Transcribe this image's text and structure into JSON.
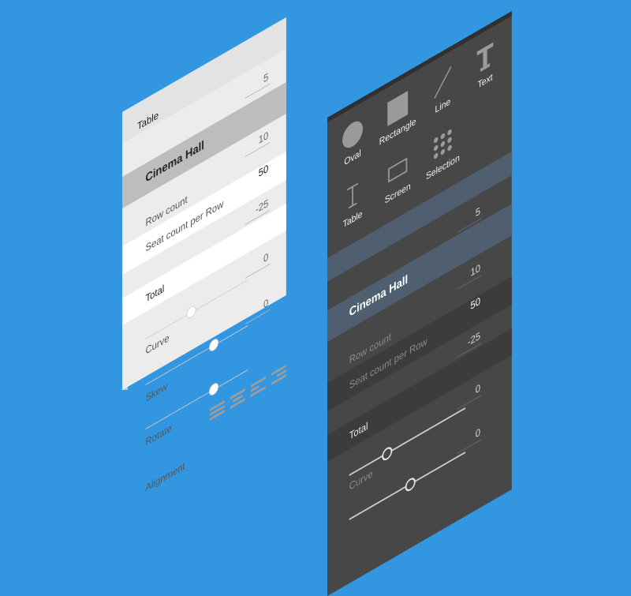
{
  "light_panel": {
    "table_label": "Table",
    "section_title": "Cinema Hall",
    "row_count_label": "Row count",
    "row_count_value": "10",
    "seat_label": "Seat count per Row",
    "seat_value": "50",
    "top_value": "5",
    "total_label": "Total",
    "total_value": "-25",
    "curve_label": "Curve",
    "curve_value": "0",
    "skew_label": "Skew",
    "skew_value": "0",
    "rotate_label": "Rotate",
    "alignment_label": "Alignment"
  },
  "dark_panel": {
    "tools": [
      {
        "label": "Oval",
        "icon": "oval-icon"
      },
      {
        "label": "Rectangle",
        "icon": "rectangle-icon"
      },
      {
        "label": "Line",
        "icon": "line-icon"
      },
      {
        "label": "Text",
        "icon": "text-icon"
      },
      {
        "label": "Table",
        "icon": "table-icon"
      },
      {
        "label": "Screen",
        "icon": "screen-icon"
      },
      {
        "label": "Selection",
        "icon": "selection-icon"
      }
    ],
    "top_value": "5",
    "section_title": "Cinema Hall",
    "row_count_label": "Row count",
    "row_count_value": "10",
    "seat_label": "Seat count per Row",
    "seat_value": "50",
    "total_label": "Total",
    "total_value": "-25",
    "curve_label": "Curve",
    "curve_value": "0",
    "second_slider_value": "0"
  },
  "colors": {
    "background": "#3396e1",
    "light_panel": "#ececec",
    "dark_panel": "#474747",
    "dark_highlight": "#4f5f70"
  }
}
